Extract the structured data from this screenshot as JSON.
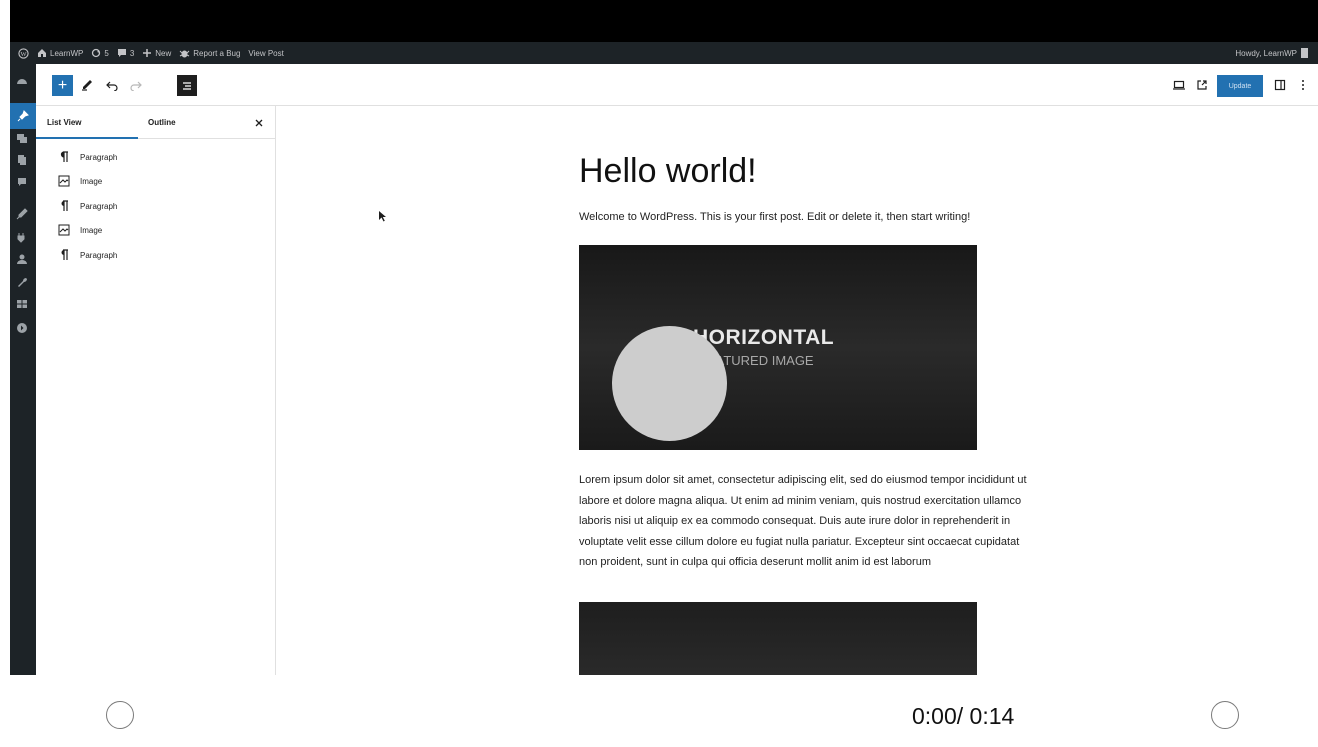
{
  "admin_bar": {
    "site_name": "LearnWP",
    "updates_count": "5",
    "comments_count": "3",
    "new_label": "New",
    "report_bug_label": "Report a Bug",
    "view_post_label": "View Post",
    "howdy_label": "Howdy, LearnWP"
  },
  "toolbar": {
    "add_label": "+",
    "update_label": "Update"
  },
  "list_panel": {
    "tab_list_view": "List View",
    "tab_outline": "Outline",
    "close_label": "×",
    "items": [
      {
        "label": "Paragraph",
        "icon": "paragraph-icon"
      },
      {
        "label": "Image",
        "icon": "image-icon"
      },
      {
        "label": "Paragraph",
        "icon": "paragraph-icon"
      },
      {
        "label": "Image",
        "icon": "image-icon"
      },
      {
        "label": "Paragraph",
        "icon": "paragraph-icon"
      }
    ]
  },
  "post": {
    "title": "Hello world!",
    "intro": "Welcome to WordPress. This is your first post. Edit or delete it, then start writing!",
    "image1_line1": "HORIZONTAL",
    "image1_line2": "FEATURED IMAGE",
    "lorem": "Lorem ipsum dolor sit amet, consectetur adipiscing elit, sed do eiusmod tempor incididunt ut labore et dolore magna aliqua. Ut enim ad minim veniam, quis nostrud exercitation ullamco laboris nisi ut aliquip ex ea commodo consequat. Duis aute irure dolor in reprehenderit in voluptate velit esse cillum dolore eu fugiat nulla pariatur. Excepteur sint occaecat cupidatat non proident, sunt in culpa qui officia deserunt mollit anim id est laborum"
  },
  "player": {
    "timecode": "0:00/ 0:14"
  },
  "colors": {
    "accent": "#2271b1",
    "admin_bg": "#1d2327"
  }
}
